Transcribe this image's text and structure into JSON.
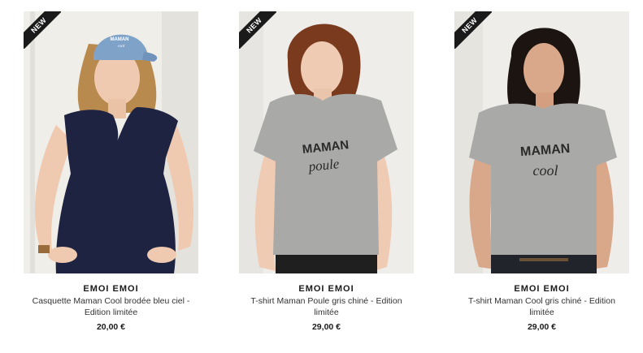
{
  "products": [
    {
      "badge": "NEW",
      "brand": "EMOI EMOI",
      "title": "Casquette Maman Cool brodée bleu ciel - Edition limitée",
      "price": "20,00 €",
      "print_line1": "MAMAN",
      "print_line2": "cool"
    },
    {
      "badge": "NEW",
      "brand": "EMOI EMOI",
      "title": "T-shirt Maman Poule gris chiné - Edition limitée",
      "price": "29,00 €",
      "print_line1": "MAMAN",
      "print_line2": "poule"
    },
    {
      "badge": "NEW",
      "brand": "EMOI EMOI",
      "title": "T-shirt Maman Cool gris chiné - Edition limitée",
      "price": "29,00 €",
      "print_line1": "MAMAN",
      "print_line2": "cool"
    }
  ],
  "colors": {
    "background": "#ffffff",
    "badge": "#1a1a1a",
    "navy_dress": "#1d2340",
    "grey_tshirt": "#a9a9a7",
    "cap": "#7fa2c9"
  }
}
